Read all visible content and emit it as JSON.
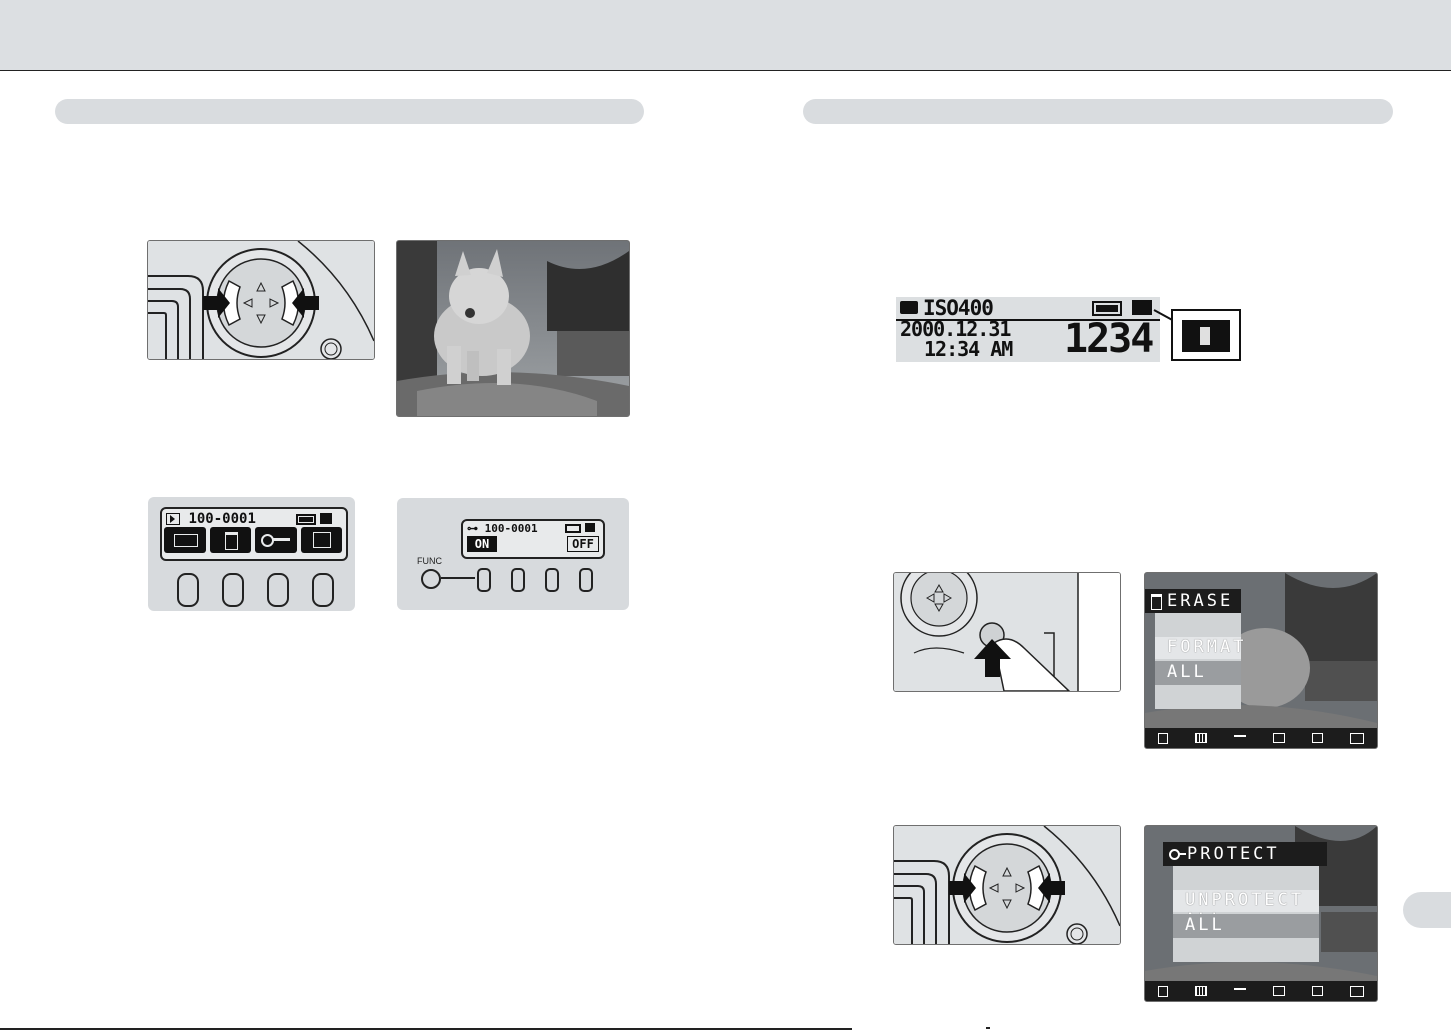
{
  "dpad": {
    "arrows": [
      "left-arrow",
      "right-arrow"
    ],
    "glyphs": [
      "◁",
      "▷",
      "△",
      "▽"
    ]
  },
  "lcd_small": {
    "file": "100-0001"
  },
  "func_panel": {
    "func_label": "FUNC",
    "file": "100-0001",
    "on_label": "ON",
    "off_label": "OFF"
  },
  "status_lcd": {
    "iso": "ISO400",
    "date": "2000.12.31",
    "time": "12:34 AM",
    "count": "1234"
  },
  "erase_menu": {
    "title": "ERASE",
    "items": [
      "FORMAT",
      "ALL"
    ]
  },
  "protect_menu": {
    "title": "PROTECT",
    "items": [
      "UNPROTECT ALL",
      "ALL"
    ]
  },
  "toolbar_icons": [
    "trash-icon",
    "grid-icon",
    "key-icon",
    "print-icon",
    "copy-icon",
    "brightness-icon"
  ],
  "colors": {
    "panel_gray": "#d9dcdf",
    "lcd_bg": "#dcdfe1",
    "menu_bg": "#1c1c1c"
  }
}
